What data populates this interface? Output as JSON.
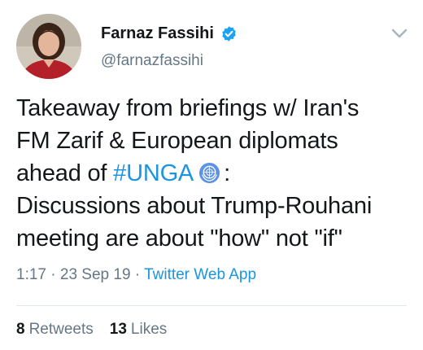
{
  "tweet": {
    "author": {
      "display_name": "Farnaz Fassihi",
      "handle": "@farnazfassihi",
      "verified_icon": "verified-badge-icon",
      "avatar_icon": "profile-photo"
    },
    "menu_icon": "chevron-down-icon",
    "text": {
      "line1": "Takeaway from briefings w/ Iran's",
      "line2": "FM Zarif & European diplomats",
      "line3_prefix": "ahead of ",
      "hashtag": "#UNGA",
      "hashtag_emoji": "un-emblem-icon",
      "line3_suffix": ":",
      "line4": "Discussions about Trump-Rouhani",
      "line5": "meeting are about \"how\" not \"if\""
    },
    "meta": {
      "time": "1:17",
      "separator1": " · ",
      "date": "23 Sep 19",
      "separator2": " · ",
      "source": "Twitter Web App"
    },
    "stats": {
      "retweets_count": "8",
      "retweets_label": "Retweets",
      "likes_count": "13",
      "likes_label": "Likes"
    },
    "colors": {
      "text": "#14171a",
      "secondary": "#657786",
      "link": "#1b95e0",
      "verified": "#1da1f2",
      "divider": "#e1e8ed"
    }
  }
}
